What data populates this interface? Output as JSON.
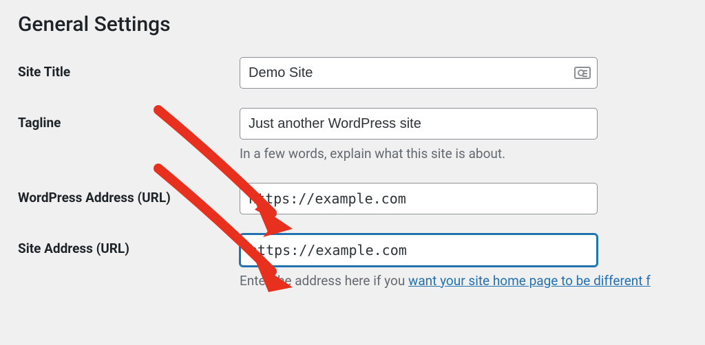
{
  "page": {
    "title": "General Settings"
  },
  "fields": {
    "site_title": {
      "label": "Site Title",
      "value": "Demo Site"
    },
    "tagline": {
      "label": "Tagline",
      "value": "Just another WordPress site",
      "desc": "In a few words, explain what this site is about."
    },
    "wp_address": {
      "label": "WordPress Address (URL)",
      "value": "https://example.com"
    },
    "site_address": {
      "label": "Site Address (URL)",
      "value": "https://example.com",
      "desc_prefix": "Enter the address here if you ",
      "desc_link": "want your site home page to be different f"
    }
  },
  "icons": {
    "contact": "contact-card-icon"
  }
}
